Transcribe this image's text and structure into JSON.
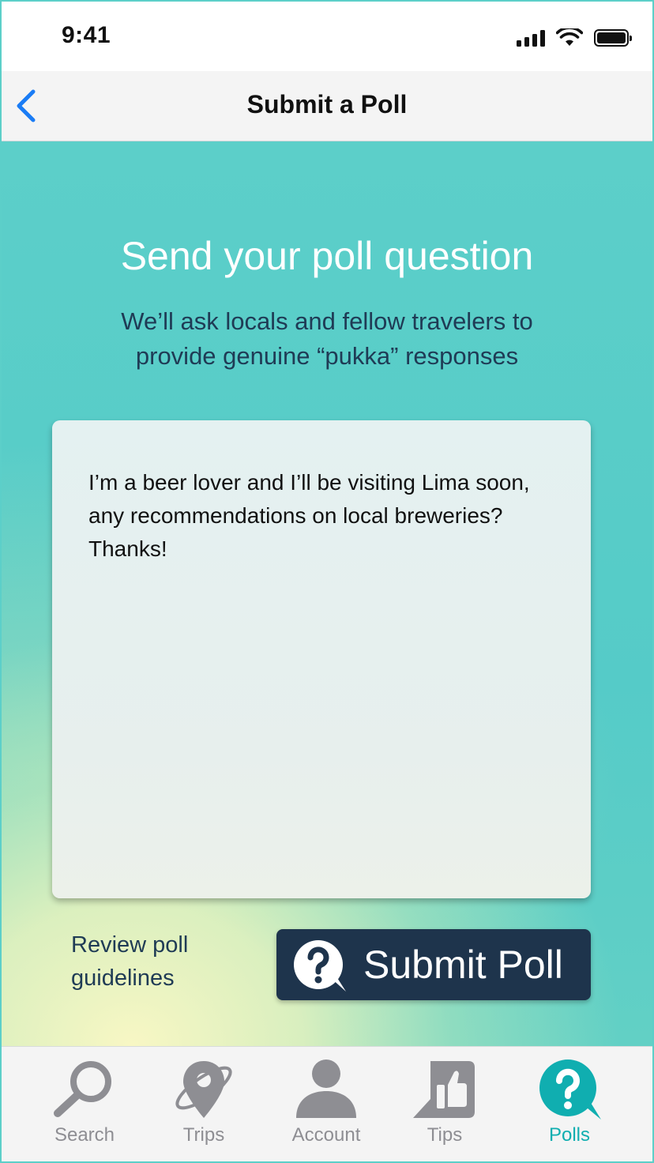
{
  "status_bar": {
    "time": "9:41"
  },
  "nav": {
    "title": "Submit a Poll"
  },
  "main": {
    "headline": "Send your poll question",
    "subhead": "We’ll ask locals and fellow travelers to provide genuine “pukka” responses",
    "question_text": "I’m a beer lover and I’ll be visiting Lima soon, any recommendations on local breweries? Thanks!",
    "guidelines_link": "Review poll guidelines",
    "submit_label": "Submit Poll"
  },
  "tabs": [
    {
      "label": "Search",
      "icon": "magnifier-icon",
      "active": false
    },
    {
      "label": "Trips",
      "icon": "trip-pin-icon",
      "active": false
    },
    {
      "label": "Account",
      "icon": "person-icon",
      "active": false
    },
    {
      "label": "Tips",
      "icon": "thumbs-up-icon",
      "active": false
    },
    {
      "label": "Polls",
      "icon": "question-bubble-icon",
      "active": true
    }
  ],
  "colors": {
    "accent": "#10aeb0",
    "navy": "#1e344c",
    "teal_bg": "#5ccfc9",
    "inactive_tab": "#8e8e93",
    "back_arrow": "#1a7cf5"
  }
}
